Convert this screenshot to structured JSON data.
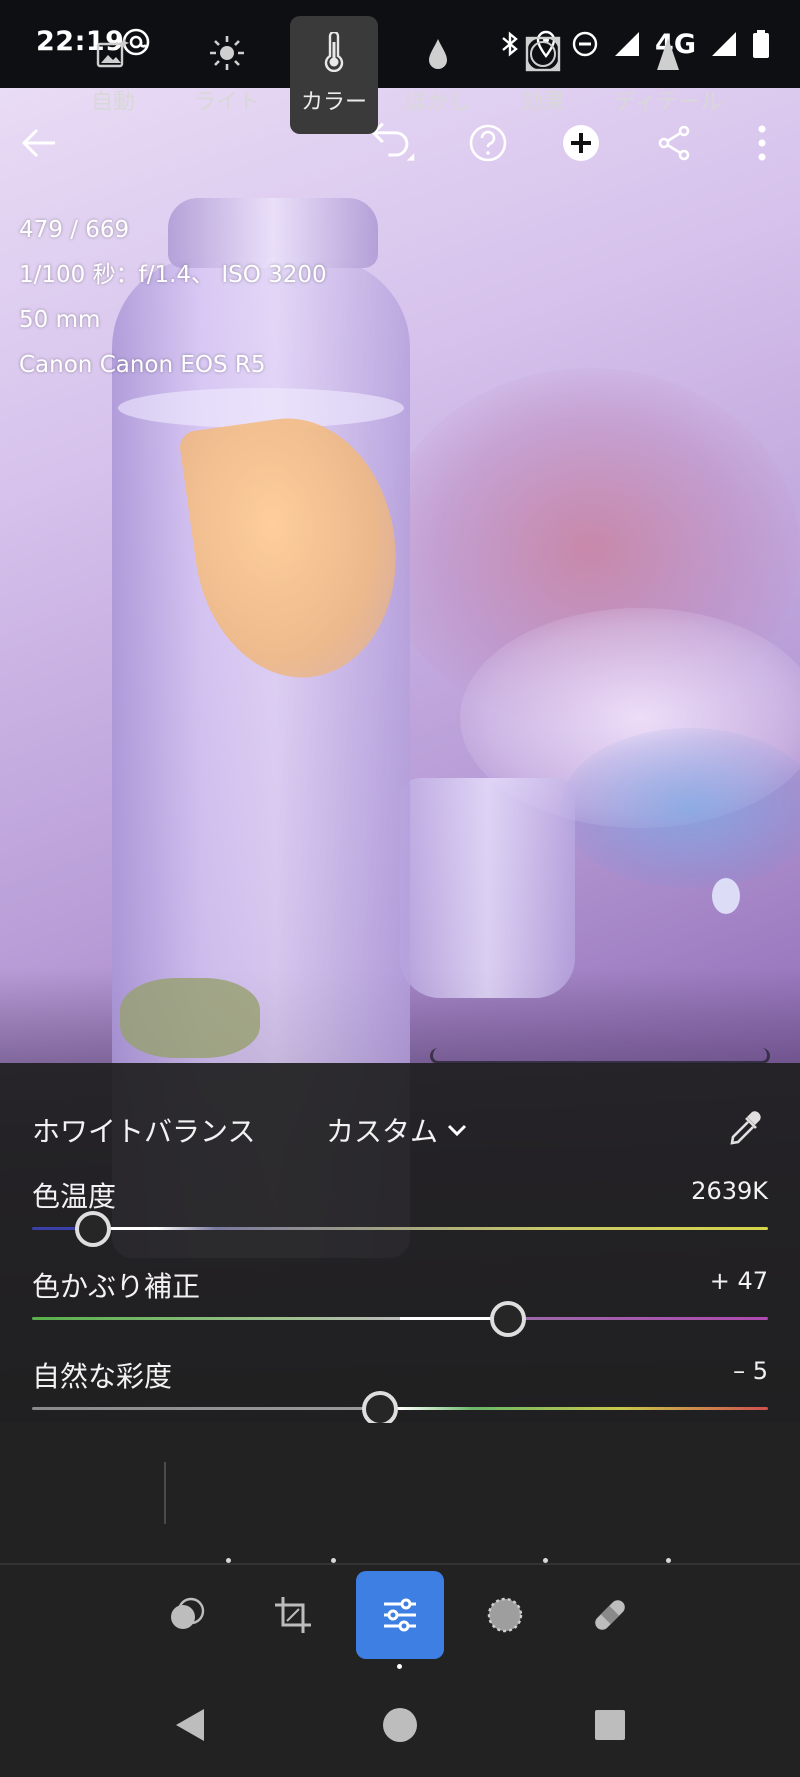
{
  "status_bar": {
    "time": "22:19",
    "network": "4G",
    "icons": [
      "at-sign-icon",
      "bluetooth-icon",
      "location-icon",
      "do-not-disturb-icon",
      "signal-icon",
      "battery-icon"
    ]
  },
  "top_bar": {
    "icons": [
      "back-arrow-icon",
      "undo-icon",
      "help-icon",
      "add-icon",
      "share-icon",
      "more-vert-icon"
    ]
  },
  "photo_info": {
    "counter": "479 / 669",
    "exposure": "1/100 秒：f/1.4、 ISO 3200",
    "focal_length": "50 mm",
    "camera": "Canon Canon EOS R5"
  },
  "white_balance": {
    "label": "ホワイトバランス",
    "mode": "カスタム"
  },
  "sliders": [
    {
      "label": "色温度",
      "value": "2639K",
      "position": 0.083
    },
    {
      "label": "色かぶり補正",
      "value": "+ 47",
      "position": 0.647
    },
    {
      "label": "自然な彩度",
      "value": "– 5",
      "position": 0.473
    }
  ],
  "tools": [
    {
      "label": "自動",
      "icon": "auto-enhance-icon",
      "active": false,
      "dot": false
    },
    {
      "label": "ライト",
      "icon": "light-sun-icon",
      "active": false,
      "dot": true
    },
    {
      "label": "カラー",
      "icon": "color-thermometer-icon",
      "active": true,
      "dot": true
    },
    {
      "label": "ぼかし",
      "icon": "blur-drop-icon",
      "active": false,
      "dot": false
    },
    {
      "label": "効果",
      "icon": "effects-vignette-icon",
      "active": false,
      "dot": true
    },
    {
      "label": "ディテール",
      "icon": "detail-triangle-icon",
      "active": false,
      "dot": true
    }
  ],
  "modes": [
    {
      "icon": "presets-icon",
      "active": false
    },
    {
      "icon": "crop-icon",
      "active": false
    },
    {
      "icon": "edit-sliders-icon",
      "active": true
    },
    {
      "icon": "masking-icon",
      "active": false
    },
    {
      "icon": "healing-bandage-icon",
      "active": false
    }
  ],
  "nav_bar": {
    "icons": [
      "nav-back-icon",
      "nav-home-icon",
      "nav-recents-icon"
    ]
  },
  "colors": {
    "accent": "#3d7fe3",
    "panel": "#202020",
    "temp_track": [
      "#3b3fa8",
      "#d6d64a"
    ],
    "tint_track": [
      "#57b04a",
      "#b04ab0"
    ]
  }
}
